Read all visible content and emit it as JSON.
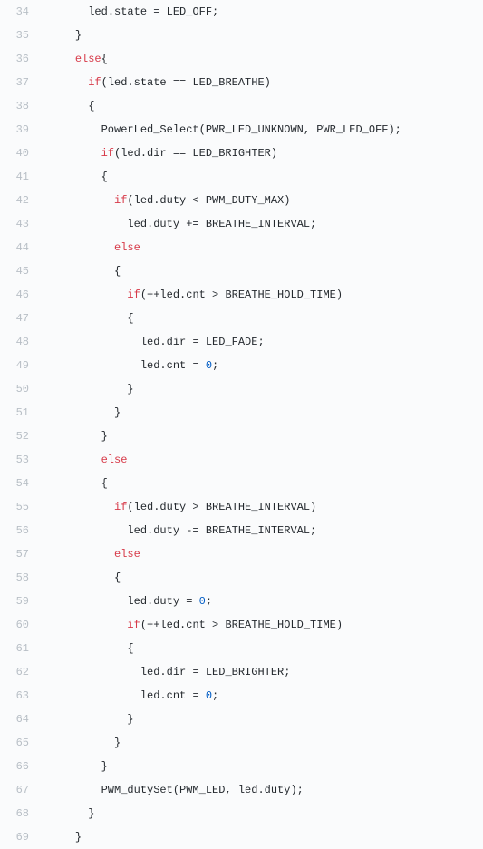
{
  "lines": [
    {
      "n": 34,
      "indent": 3,
      "tokens": [
        {
          "t": "led.state = LED_OFF;",
          "c": "id"
        }
      ]
    },
    {
      "n": 35,
      "indent": 2,
      "tokens": [
        {
          "t": "}",
          "c": "id"
        }
      ]
    },
    {
      "n": 36,
      "indent": 2,
      "tokens": [
        {
          "t": "else",
          "c": "kw"
        },
        {
          "t": "{",
          "c": "id"
        }
      ]
    },
    {
      "n": 37,
      "indent": 3,
      "tokens": [
        {
          "t": "if",
          "c": "kw"
        },
        {
          "t": "(led.state == LED_BREATHE)",
          "c": "id"
        }
      ]
    },
    {
      "n": 38,
      "indent": 3,
      "tokens": [
        {
          "t": "{",
          "c": "id"
        }
      ]
    },
    {
      "n": 39,
      "indent": 4,
      "tokens": [
        {
          "t": "PowerLed_Select(PWR_LED_UNKNOWN, PWR_LED_OFF);",
          "c": "id"
        }
      ]
    },
    {
      "n": 40,
      "indent": 4,
      "tokens": [
        {
          "t": "if",
          "c": "kw"
        },
        {
          "t": "(led.dir == LED_BRIGHTER)",
          "c": "id"
        }
      ]
    },
    {
      "n": 41,
      "indent": 4,
      "tokens": [
        {
          "t": "{",
          "c": "id"
        }
      ]
    },
    {
      "n": 42,
      "indent": 5,
      "tokens": [
        {
          "t": "if",
          "c": "kw"
        },
        {
          "t": "(led.duty < PWM_DUTY_MAX)",
          "c": "id"
        }
      ]
    },
    {
      "n": 43,
      "indent": 6,
      "tokens": [
        {
          "t": "led.duty += BREATHE_INTERVAL;",
          "c": "id"
        }
      ]
    },
    {
      "n": 44,
      "indent": 5,
      "tokens": [
        {
          "t": "else",
          "c": "kw"
        }
      ]
    },
    {
      "n": 45,
      "indent": 5,
      "tokens": [
        {
          "t": "{",
          "c": "id"
        }
      ]
    },
    {
      "n": 46,
      "indent": 6,
      "tokens": [
        {
          "t": "if",
          "c": "kw"
        },
        {
          "t": "(++led.cnt > BREATHE_HOLD_TIME)",
          "c": "id"
        }
      ]
    },
    {
      "n": 47,
      "indent": 6,
      "tokens": [
        {
          "t": "{",
          "c": "id"
        }
      ]
    },
    {
      "n": 48,
      "indent": 7,
      "tokens": [
        {
          "t": "led.dir = LED_FADE;",
          "c": "id"
        }
      ]
    },
    {
      "n": 49,
      "indent": 7,
      "tokens": [
        {
          "t": "led.cnt = ",
          "c": "id"
        },
        {
          "t": "0",
          "c": "num"
        },
        {
          "t": ";",
          "c": "id"
        }
      ]
    },
    {
      "n": 50,
      "indent": 6,
      "tokens": [
        {
          "t": "}",
          "c": "id"
        }
      ]
    },
    {
      "n": 51,
      "indent": 5,
      "tokens": [
        {
          "t": "}",
          "c": "id"
        }
      ]
    },
    {
      "n": 52,
      "indent": 4,
      "tokens": [
        {
          "t": "}",
          "c": "id"
        }
      ]
    },
    {
      "n": 53,
      "indent": 4,
      "tokens": [
        {
          "t": "else",
          "c": "kw"
        }
      ]
    },
    {
      "n": 54,
      "indent": 4,
      "tokens": [
        {
          "t": "{",
          "c": "id"
        }
      ]
    },
    {
      "n": 55,
      "indent": 5,
      "tokens": [
        {
          "t": "if",
          "c": "kw"
        },
        {
          "t": "(led.duty > BREATHE_INTERVAL)",
          "c": "id"
        }
      ]
    },
    {
      "n": 56,
      "indent": 6,
      "tokens": [
        {
          "t": "led.duty -= BREATHE_INTERVAL;",
          "c": "id"
        }
      ]
    },
    {
      "n": 57,
      "indent": 5,
      "tokens": [
        {
          "t": "else",
          "c": "kw"
        }
      ]
    },
    {
      "n": 58,
      "indent": 5,
      "tokens": [
        {
          "t": "{",
          "c": "id"
        }
      ]
    },
    {
      "n": 59,
      "indent": 6,
      "tokens": [
        {
          "t": "led.duty = ",
          "c": "id"
        },
        {
          "t": "0",
          "c": "num"
        },
        {
          "t": ";",
          "c": "id"
        }
      ]
    },
    {
      "n": 60,
      "indent": 6,
      "tokens": [
        {
          "t": "if",
          "c": "kw"
        },
        {
          "t": "(++led.cnt > BREATHE_HOLD_TIME)",
          "c": "id"
        }
      ]
    },
    {
      "n": 61,
      "indent": 6,
      "tokens": [
        {
          "t": "{",
          "c": "id"
        }
      ]
    },
    {
      "n": 62,
      "indent": 7,
      "tokens": [
        {
          "t": "led.dir = LED_BRIGHTER;",
          "c": "id"
        }
      ]
    },
    {
      "n": 63,
      "indent": 7,
      "tokens": [
        {
          "t": "led.cnt = ",
          "c": "id"
        },
        {
          "t": "0",
          "c": "num"
        },
        {
          "t": ";",
          "c": "id"
        }
      ]
    },
    {
      "n": 64,
      "indent": 6,
      "tokens": [
        {
          "t": "}",
          "c": "id"
        }
      ]
    },
    {
      "n": 65,
      "indent": 5,
      "tokens": [
        {
          "t": "}",
          "c": "id"
        }
      ]
    },
    {
      "n": 66,
      "indent": 4,
      "tokens": [
        {
          "t": "}",
          "c": "id"
        }
      ]
    },
    {
      "n": 67,
      "indent": 4,
      "tokens": [
        {
          "t": "PWM_dutySet(PWM_LED, led.duty);",
          "c": "id"
        }
      ]
    },
    {
      "n": 68,
      "indent": 3,
      "tokens": [
        {
          "t": "}",
          "c": "id"
        }
      ]
    },
    {
      "n": 69,
      "indent": 2,
      "tokens": [
        {
          "t": "}",
          "c": "id"
        }
      ]
    }
  ],
  "indent_unit": "  "
}
